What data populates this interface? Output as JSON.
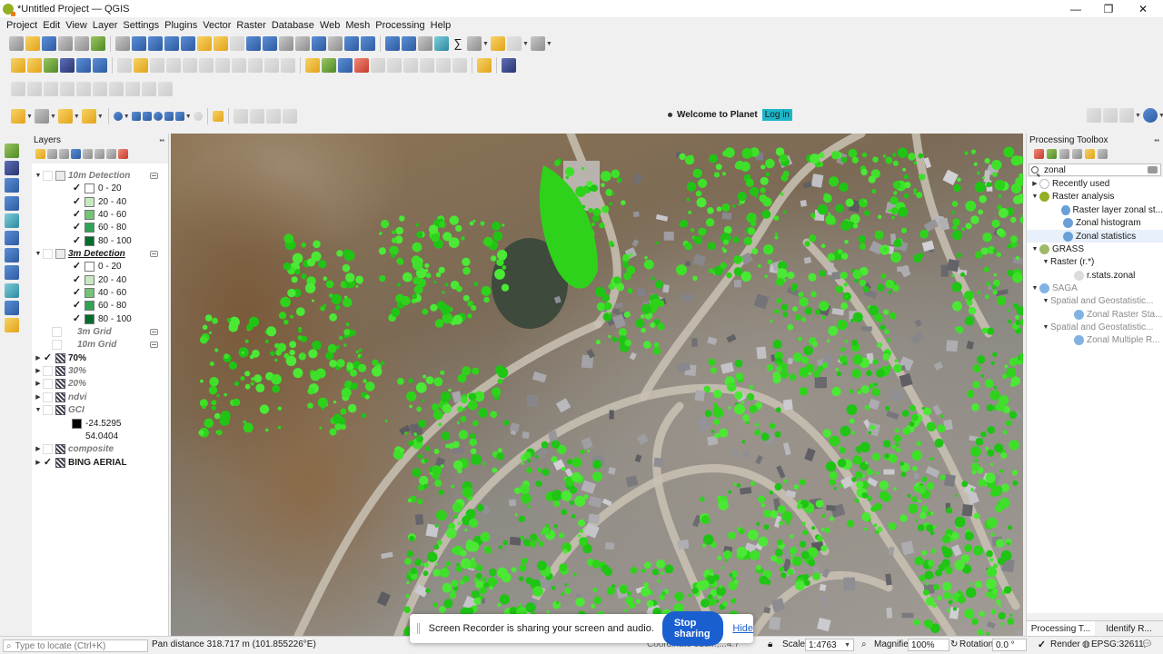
{
  "window": {
    "title": "*Untitled Project — QGIS",
    "minimize": "—",
    "maximize": "❐",
    "close": "✕"
  },
  "menu": [
    "Project",
    "Edit",
    "View",
    "Layer",
    "Settings",
    "Plugins",
    "Vector",
    "Raster",
    "Database",
    "Web",
    "Mesh",
    "Processing",
    "Help"
  ],
  "planet": {
    "welcome": "Welcome to Planet",
    "login": "Log in"
  },
  "layers_panel": {
    "title": "Layers",
    "items": [
      {
        "label": "10m Detection",
        "checked": false,
        "type": "group-italic",
        "expanded": true
      },
      {
        "label": "0 - 20",
        "checked": true,
        "swatch": "#ffffff"
      },
      {
        "label": "20 - 40",
        "checked": true,
        "swatch": "#c7e9c0"
      },
      {
        "label": "40 - 60",
        "checked": true,
        "swatch": "#74c476"
      },
      {
        "label": "60 - 80",
        "checked": true,
        "swatch": "#31a354"
      },
      {
        "label": "80 - 100",
        "checked": true,
        "swatch": "#006d2c"
      },
      {
        "label": "3m Detection",
        "checked": false,
        "type": "group-selected",
        "expanded": true
      },
      {
        "label": "0 - 20",
        "checked": true,
        "swatch": "#ffffff"
      },
      {
        "label": "20 - 40",
        "checked": true,
        "swatch": "#c7e9c0"
      },
      {
        "label": "40 - 60",
        "checked": true,
        "swatch": "#74c476"
      },
      {
        "label": "60 - 80",
        "checked": true,
        "swatch": "#31a354"
      },
      {
        "label": "80 - 100",
        "checked": true,
        "swatch": "#006d2c"
      },
      {
        "label": "3m Grid",
        "checked": false,
        "type": "vector-italic"
      },
      {
        "label": "10m Grid",
        "checked": false,
        "type": "vector-italic"
      },
      {
        "label": "70%",
        "checked": true,
        "type": "raster-bold"
      },
      {
        "label": "30%",
        "checked": false,
        "type": "raster-italic"
      },
      {
        "label": "20%",
        "checked": false,
        "type": "raster-italic"
      },
      {
        "label": "ndvi",
        "checked": false,
        "type": "raster-italic"
      },
      {
        "label": "GCI",
        "checked": false,
        "type": "raster-italic",
        "expanded": true
      },
      {
        "label": "-24.5295",
        "type": "ramp-min",
        "swatch": "#000000"
      },
      {
        "label": "54.0404",
        "type": "ramp-max"
      },
      {
        "label": "composite",
        "checked": false,
        "type": "raster-italic"
      },
      {
        "label": "BING AERIAL",
        "checked": true,
        "type": "raster-bold"
      }
    ]
  },
  "toolbox": {
    "title": "Processing Toolbox",
    "search_value": "zonal",
    "items": [
      {
        "label": "Recently used",
        "level": 0,
        "arrow": "▶",
        "icon": "clock-icon",
        "dim": false
      },
      {
        "label": "Raster analysis",
        "level": 0,
        "arrow": "▼",
        "icon": "qgis-icon",
        "dim": false
      },
      {
        "label": "Raster layer zonal st...",
        "level": 2,
        "arrow": "",
        "icon": "gear-icon",
        "dim": false
      },
      {
        "label": "Zonal histogram",
        "level": 2,
        "arrow": "",
        "icon": "gear-icon",
        "dim": false
      },
      {
        "label": "Zonal statistics",
        "level": 2,
        "arrow": "",
        "icon": "gear-icon",
        "dim": false,
        "selected": true
      },
      {
        "label": "GRASS",
        "level": 0,
        "arrow": "▼",
        "icon": "grass-icon",
        "dim": false
      },
      {
        "label": "Raster (r.*)",
        "level": 1,
        "arrow": "▼",
        "icon": "",
        "dim": false
      },
      {
        "label": "r.stats.zonal",
        "level": 3,
        "arrow": "",
        "icon": "script-icon",
        "dim": false
      },
      {
        "label": "SAGA",
        "level": 0,
        "arrow": "▼",
        "icon": "saga-icon",
        "dim": true
      },
      {
        "label": "Spatial and Geostatistic...",
        "level": 1,
        "arrow": "▼",
        "icon": "",
        "dim": true
      },
      {
        "label": "Zonal Raster Sta...",
        "level": 3,
        "arrow": "",
        "icon": "saga-icon",
        "dim": true
      },
      {
        "label": "Spatial and Geostatistic...",
        "level": 1,
        "arrow": "▼",
        "icon": "",
        "dim": true
      },
      {
        "label": "Zonal Multiple R...",
        "level": 3,
        "arrow": "",
        "icon": "saga-icon",
        "dim": true
      }
    ],
    "tabs": [
      "Processing T...",
      "Identify R..."
    ]
  },
  "recorder": {
    "message": "Screen Recorder is sharing your screen and audio.",
    "stop": "Stop sharing",
    "hide": "Hide"
  },
  "status": {
    "locate_placeholder": "Type to locate (Ctrl+K)",
    "pan_distance": "Pan distance 318.717 m (101.855226°E)",
    "coordinate_tail": "Coordinate 318...,...4.7",
    "scale_label": "Scale",
    "scale_value": "1:4763",
    "magnifier_label": "Magnifier",
    "magnifier_value": "100%",
    "rotation_label": "Rotation",
    "rotation_value": "0.0 °",
    "render_label": "Render",
    "crs": "EPSG:32611"
  }
}
